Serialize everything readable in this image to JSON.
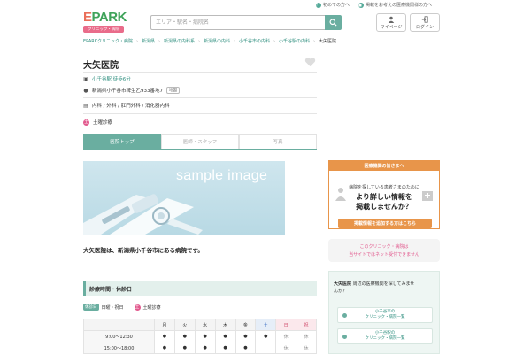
{
  "util_links": {
    "first_time": "初めての方へ",
    "contact": "掲載をお考えの医療機関様の方へ"
  },
  "logo": {
    "word_e": "E",
    "word_rest": "PARK",
    "sub": "クリニック・病院"
  },
  "search": {
    "placeholder": "エリア・駅名・病院名"
  },
  "header": {
    "mypage": "マイページ",
    "login": "ログイン"
  },
  "breadcrumbs": [
    "EPARKクリニック・病院",
    "新潟県",
    "新潟県の内科系",
    "新潟県の内科",
    "小千谷市の内科",
    "小千谷駅の内科",
    "大矢医院"
  ],
  "clinic": {
    "name": "大矢医院",
    "access": "小千谷駅 徒歩6分",
    "address": "新潟県小千谷市稗生乙933番地7",
    "map_label": "地図",
    "departments": "内科 / 外科 / 肛門外科 / 消化器内科",
    "sat_label": "土曜診療"
  },
  "tabs": [
    {
      "label": "医院トップ",
      "active": true
    },
    {
      "label": "医師・スタッフ",
      "active": false
    },
    {
      "label": "写真",
      "active": false
    }
  ],
  "sample_image": {
    "text": "sample image"
  },
  "intro": "大矢医院は、新潟県小千谷市にある病院です。",
  "hours": {
    "heading": "診療時間・休診日",
    "closed_badge": "休診日",
    "closed_days": "日曜・祝日",
    "sat_label": "土曜診療",
    "days": [
      "月",
      "火",
      "水",
      "木",
      "金",
      "土",
      "日",
      "祝"
    ],
    "rows": [
      {
        "time": "9:00〜12:30",
        "cells": [
          "●",
          "●",
          "●",
          "●",
          "●",
          "●",
          "休",
          "休"
        ]
      },
      {
        "time": "15:00〜18:00",
        "cells": [
          "●",
          "●",
          "●",
          "●",
          "●",
          "",
          "休",
          "休"
        ]
      }
    ]
  },
  "sidebar": {
    "promo_head": "医療機関の皆さまへ",
    "promo_sub": "病院を探している患者さまのために",
    "promo_main1": "より詳しい情報を",
    "promo_main2": "掲載しませんか？",
    "promo_button": "掲載情報を追加する方はこちら",
    "notice_line1": "このクリニック・病院は",
    "notice_line2": "当サイトではネット受付できません",
    "nearby_prefix": "大矢医院",
    "nearby_rest1": " 周辺の医療機関を探してみませ",
    "nearby_rest2": "んか？",
    "nearby_links": [
      {
        "line1": "小千谷市の",
        "line2": "クリニック・病院一覧"
      },
      {
        "line1": "小千谷駅の",
        "line2": "クリニック・病院一覧"
      }
    ]
  },
  "colors": {
    "brand_green": "#6aaea0",
    "accent_orange": "#e8954a",
    "accent_pink": "#e25a8e"
  }
}
